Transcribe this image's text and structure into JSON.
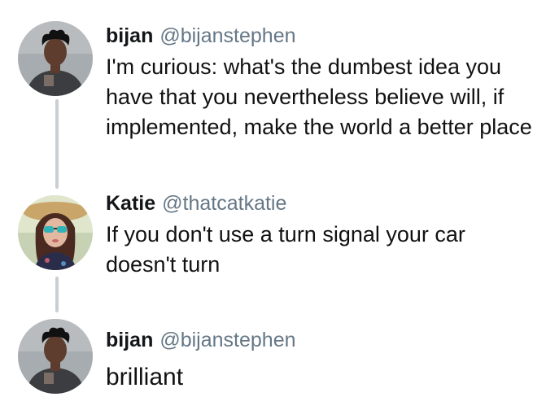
{
  "tweets": [
    {
      "name": "bijan",
      "handle": "@bijanstephen",
      "text": "I'm curious: what's the dumbest idea you have that you nevertheless believe will, if implemented, make the world a better place",
      "avatar_icon": "bijan-avatar"
    },
    {
      "name": "Katie",
      "handle": "@thatcatkatie",
      "text": "If you don't use a turn signal your car doesn't turn",
      "avatar_icon": "katie-avatar"
    },
    {
      "name": "bijan",
      "handle": "@bijanstephen",
      "text": "brilliant",
      "avatar_icon": "bijan-avatar"
    }
  ],
  "colors": {
    "background": "#ffffff",
    "name": "#14171a",
    "handle": "#657786",
    "thread_line": "#c9ced3"
  }
}
